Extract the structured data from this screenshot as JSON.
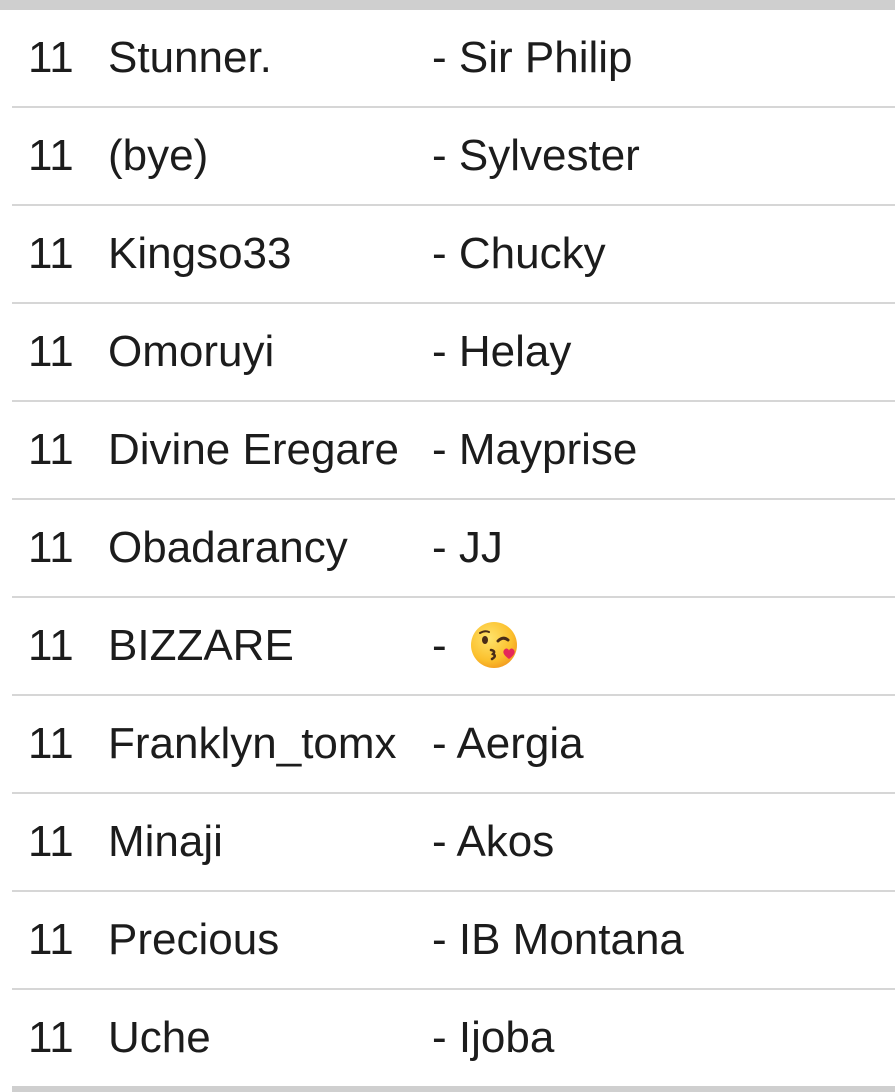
{
  "rows": [
    {
      "num": "11",
      "name": "Stunner.",
      "partner": "- Sir Philip"
    },
    {
      "num": "11",
      "name": "(bye)",
      "partner": "- Sylvester"
    },
    {
      "num": "11",
      "name": "Kingso33",
      "partner": "- Chucky"
    },
    {
      "num": "11",
      "name": "Omoruyi",
      "partner": "- Helay"
    },
    {
      "num": "11",
      "name": "Divine Eregare",
      "partner": "- Mayprise"
    },
    {
      "num": "11",
      "name": "Obadarancy",
      "partner": "- JJ"
    },
    {
      "num": "11",
      "name": "BIZZARE",
      "partner": "- ",
      "partner_icon": "face-blowing-kiss-emoji-icon"
    },
    {
      "num": "11",
      "name": "Franklyn_tomx",
      "partner": "- Aergia"
    },
    {
      "num": "11",
      "name": "Minaji",
      "partner": "- Akos"
    },
    {
      "num": "11",
      "name": "Precious",
      "partner": "- IB Montana"
    },
    {
      "num": "11",
      "name": "Uche",
      "partner": "- Ijoba"
    }
  ]
}
